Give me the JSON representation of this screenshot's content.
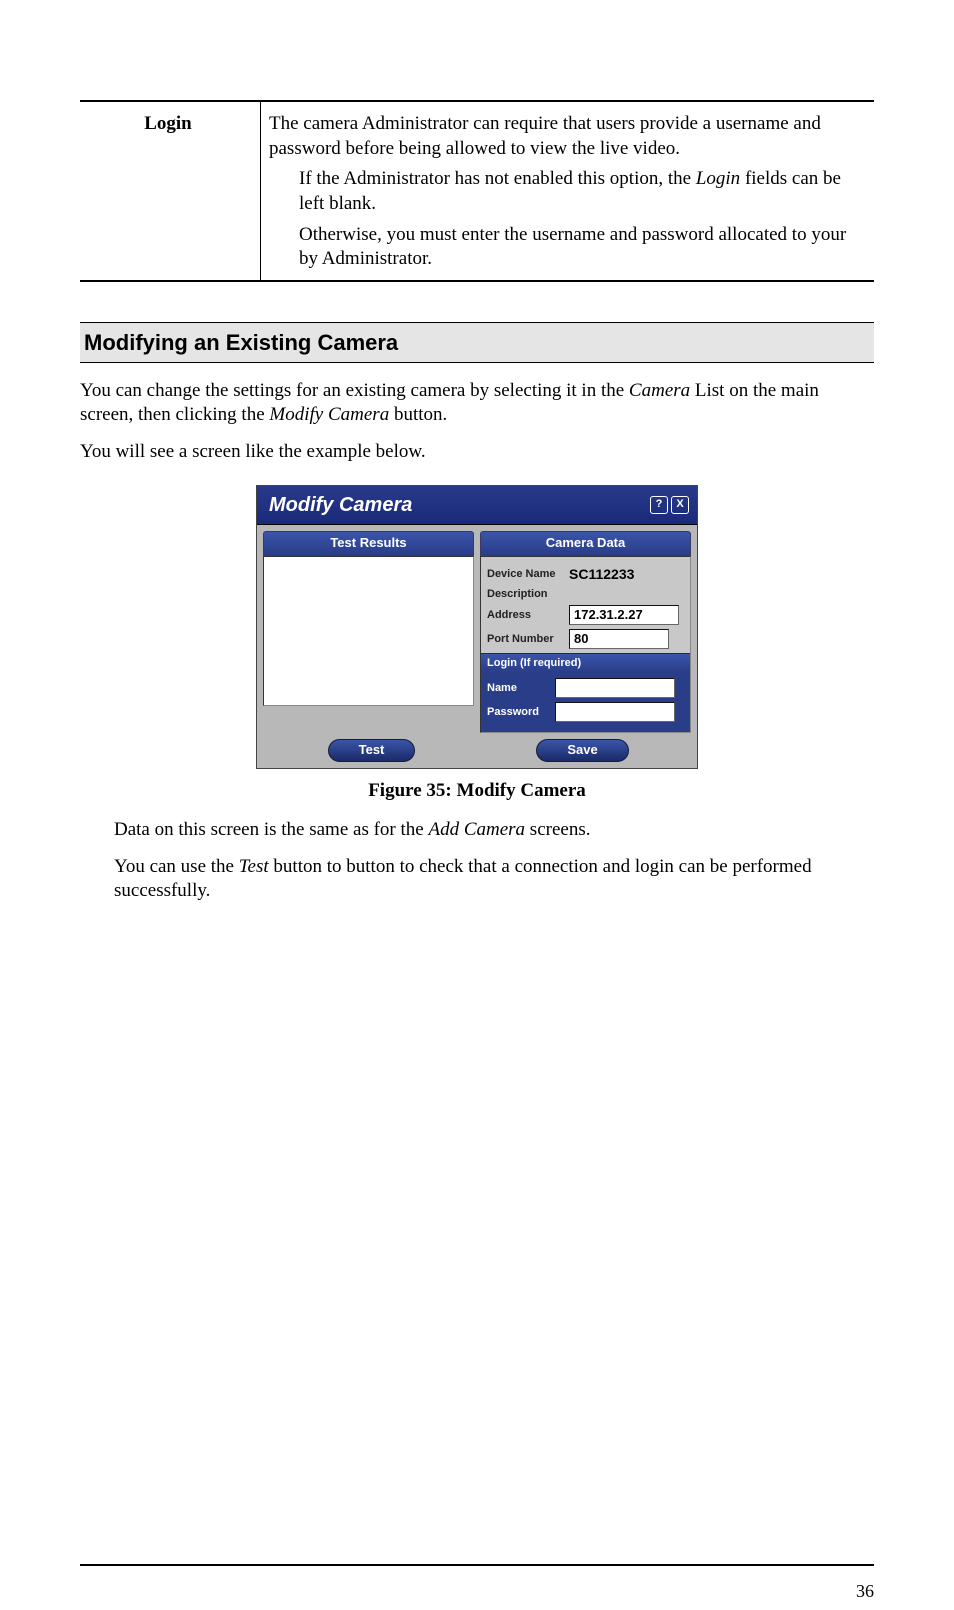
{
  "table": {
    "label": "Login",
    "main": "The camera Administrator can require that users provide a username and password before being allowed to view the live video.",
    "sub1_a": "If the Administrator has not enabled this option, the ",
    "sub1_italic": "Login",
    "sub1_b": " fields can be left blank.",
    "sub2": "Otherwise, you must enter the username and password allocated to your by Administrator."
  },
  "heading": "Modifying an Existing Camera",
  "intro1_a": "You can change the settings for an existing camera by selecting it in the ",
  "intro1_b": "Camera",
  "intro1_c": " List on the main screen, then clicking the ",
  "intro1_d": "Modify Camera",
  "intro1_e": " button.",
  "intro2": "You will see a screen like the example below.",
  "dialog": {
    "title": "Modify Camera",
    "help": "?",
    "close": "X",
    "left_header": "Test Results",
    "right_header": "Camera Data",
    "device_name_label": "Device Name",
    "device_name_value": "SC112233",
    "description_label": "Description",
    "address_label": "Address",
    "address_value": "172.31.2.27",
    "port_label": "Port Number",
    "port_value": "80",
    "login_header": "Login (If required)",
    "name_label": "Name",
    "name_value": "",
    "password_label": "Password",
    "password_value": "",
    "test_btn": "Test",
    "save_btn": "Save"
  },
  "caption": "Figure 35: Modify Camera",
  "after1_a": "Data on this screen is the same as for the ",
  "after1_b": "Add Camera",
  "after1_c": " screens.",
  "after2_a": "You can use the ",
  "after2_b": "Test",
  "after2_c": " button to button to check that a connection and login can be performed successfully.",
  "page_number": "36"
}
